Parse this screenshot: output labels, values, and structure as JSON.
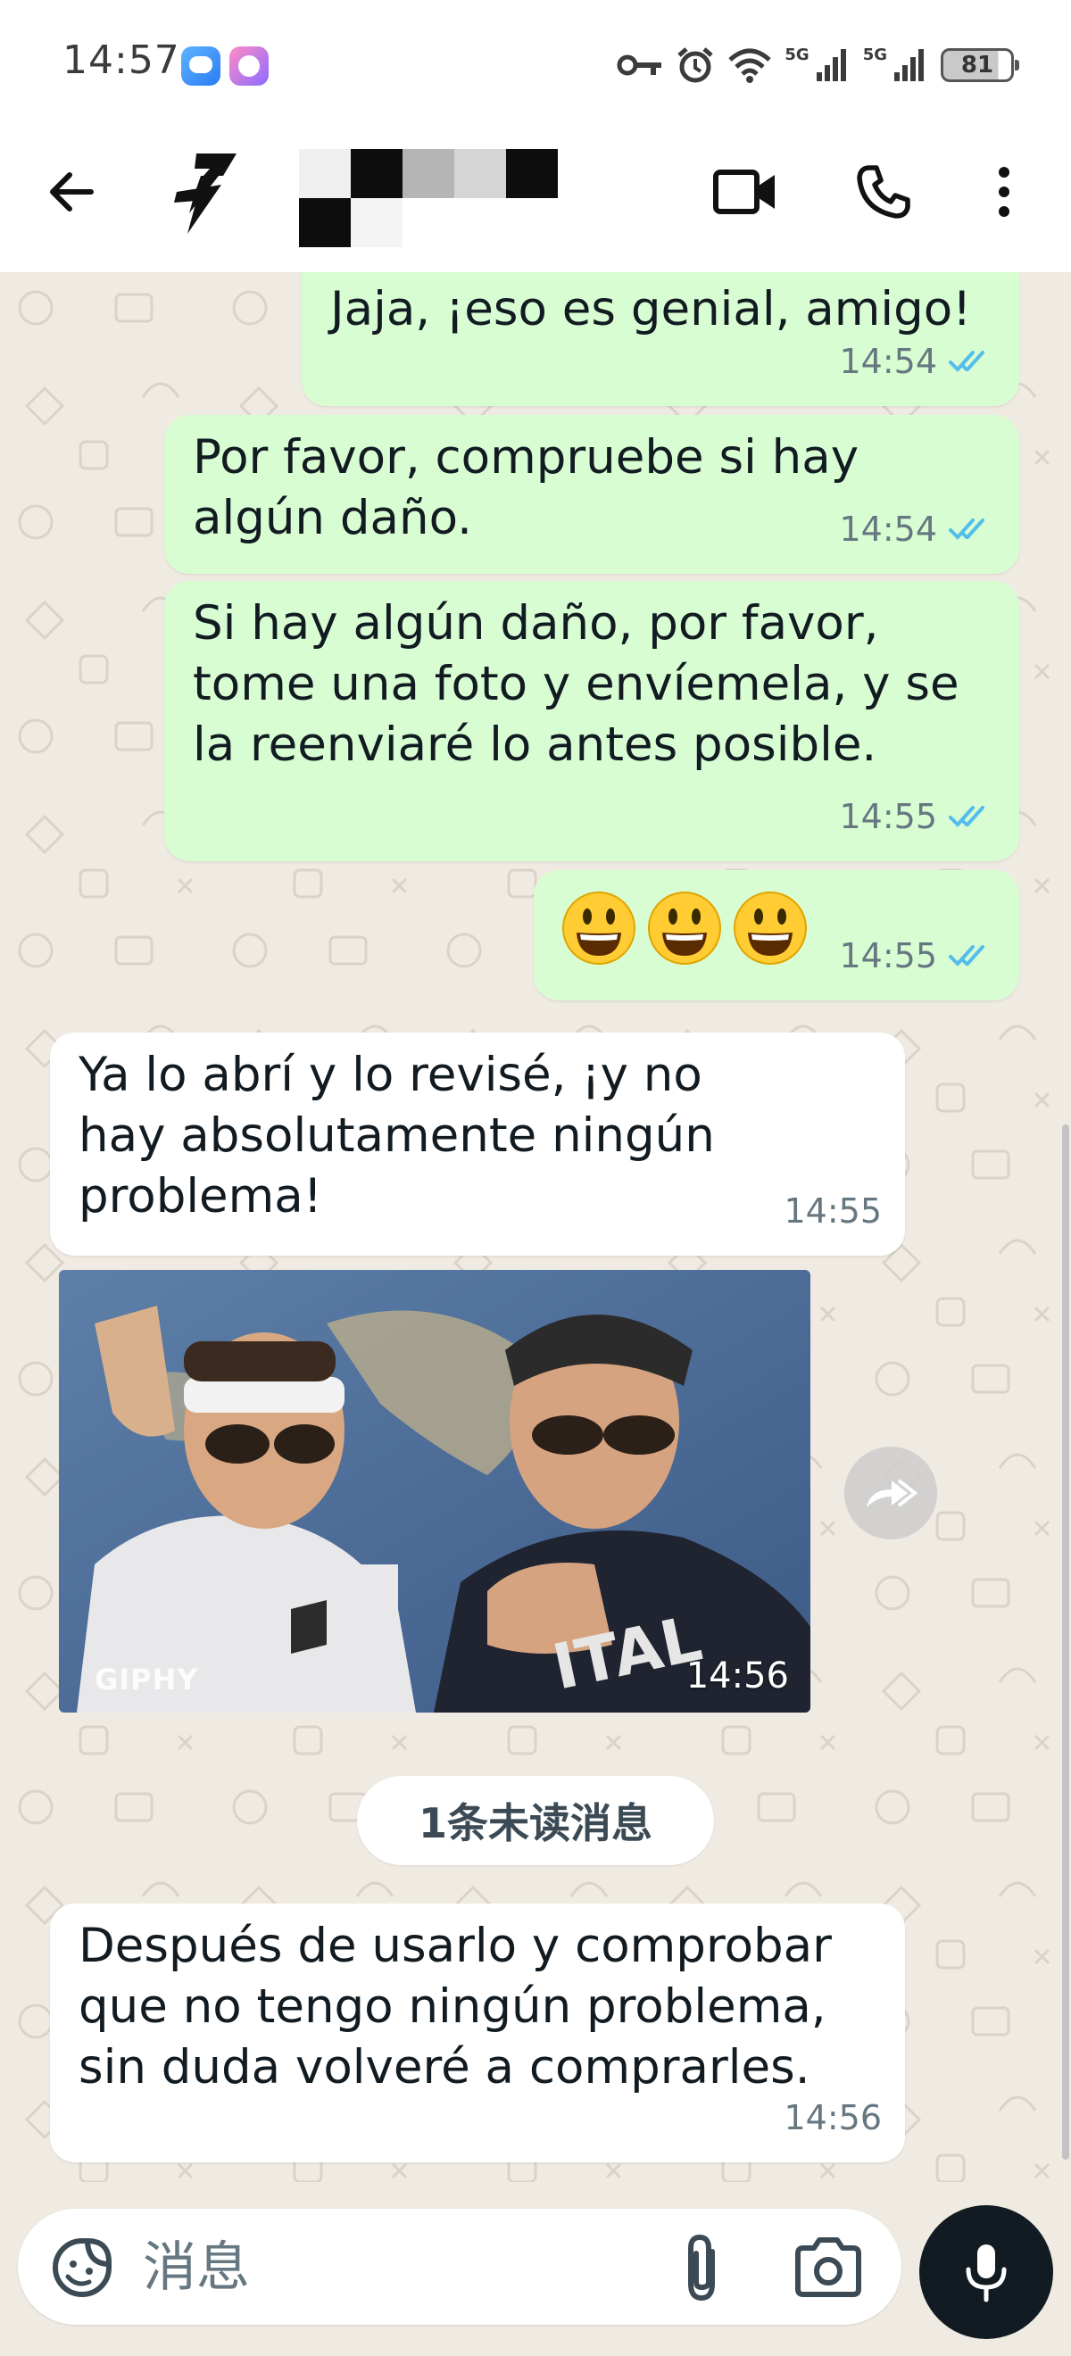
{
  "status_bar": {
    "time": "14:57",
    "network_1": "5G",
    "network_2": "5G",
    "battery": "81",
    "icons": [
      "message-app-icon",
      "pet-app-icon",
      "key-icon",
      "alarm-icon",
      "wifi-icon",
      "signal-icon",
      "signal-icon",
      "battery-icon"
    ]
  },
  "header": {
    "back_icon": "arrow-left-icon",
    "avatar_icon": "lightning-logo-icon",
    "contact_name_censored": true,
    "actions": [
      "video-call-icon",
      "phone-icon",
      "more-vertical-icon"
    ]
  },
  "messages": [
    {
      "direction": "out",
      "text": "Jaja, ¡eso es genial, amigo!",
      "time": "14:54",
      "status": "read"
    },
    {
      "direction": "out",
      "text": "Por favor, compruebe si hay\nalgún daño.",
      "time": "14:54",
      "status": "read"
    },
    {
      "direction": "out",
      "text": "Si hay algún daño, por favor,\ntome una foto y envíemela, y se\nla reenviaré lo antes posible.",
      "time": "14:55",
      "status": "read"
    },
    {
      "direction": "out",
      "emojis": [
        "😃",
        "😃",
        "😃"
      ],
      "time": "14:55",
      "status": "read"
    },
    {
      "direction": "in",
      "text": "Ya lo abrí y lo revisé, ¡y no\nhay absolutamente ningún\nproblema!",
      "time": "14:55"
    },
    {
      "direction": "in",
      "type": "gif",
      "watermark": "GIPHY",
      "time": "14:56"
    },
    {
      "direction": "in",
      "text": "Después de usarlo y comprobar\nque no tengo ningún problema,\nsin duda volveré a comprarles.",
      "time": "14:56"
    }
  ],
  "unread_divider": "1条未读消息",
  "composer": {
    "placeholder": "消息",
    "icons": [
      "sticker-icon",
      "paperclip-icon",
      "camera-icon",
      "microphone-icon"
    ]
  },
  "colors": {
    "outgoing_bubble": "#d9fdd3",
    "incoming_bubble": "#ffffff",
    "chat_background": "#efeae2",
    "read_ticks": "#53bdeb",
    "mic_button": "#111b21"
  }
}
